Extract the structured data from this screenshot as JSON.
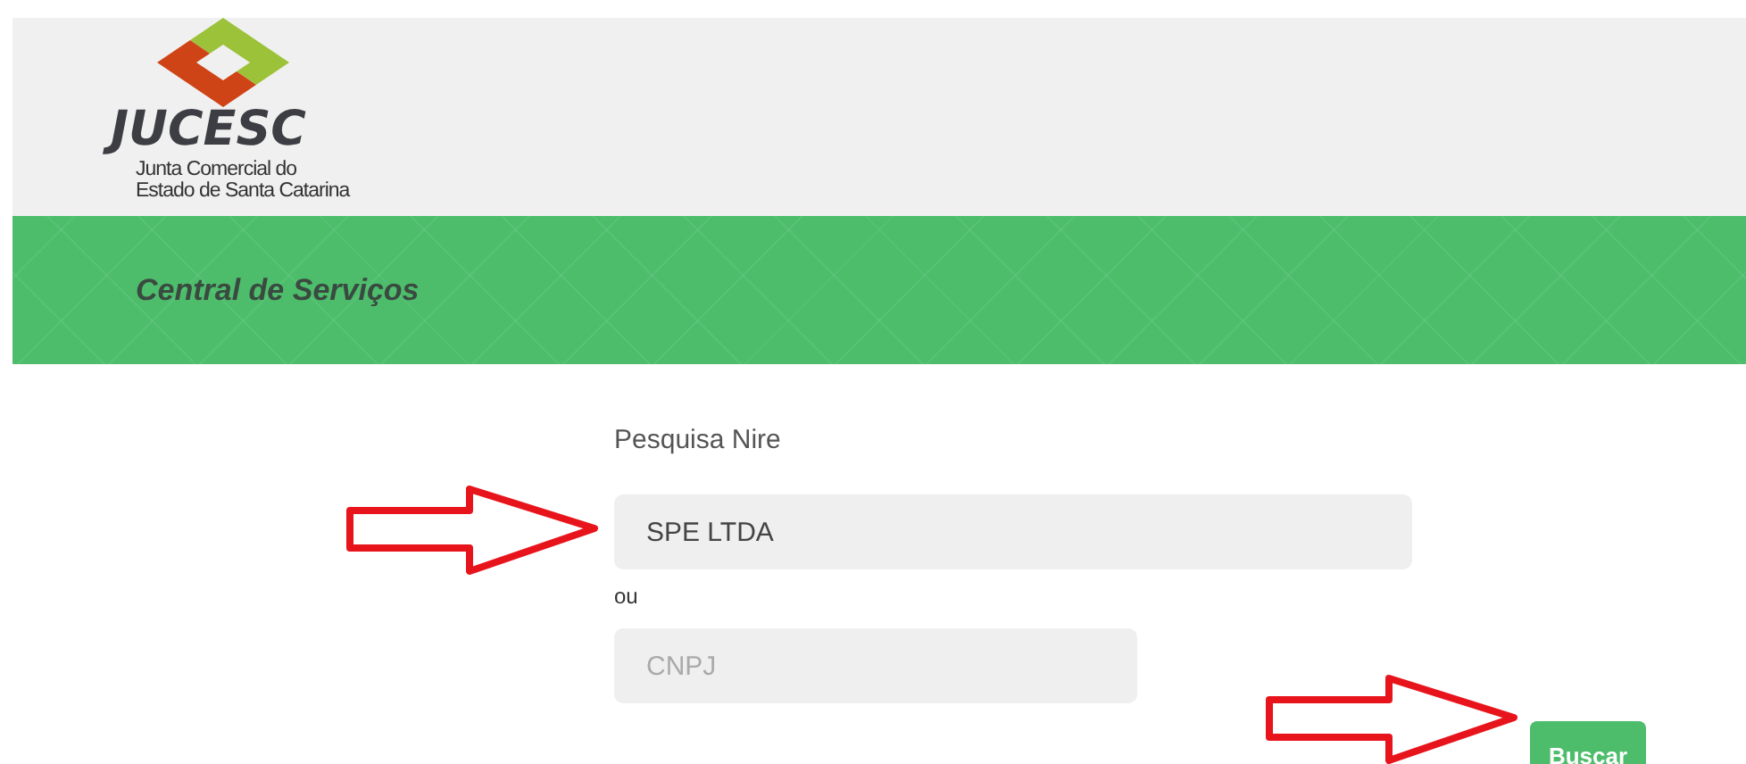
{
  "header": {
    "logo": {
      "wordmark": "JUCESC",
      "subtitle_lines": [
        "Junta Comercial do",
        "Estado de Santa Catarina"
      ]
    }
  },
  "banner": {
    "title": "Central de Serviços"
  },
  "form": {
    "heading": "Pesquisa Nire",
    "fields": [
      {
        "value": "SPE LTDA"
      },
      {
        "placeholder": "CNPJ"
      }
    ],
    "separator": "ou",
    "button": "Buscar"
  },
  "annotations": [
    {
      "kind": "arrow"
    },
    {
      "kind": "arrow"
    }
  ]
}
